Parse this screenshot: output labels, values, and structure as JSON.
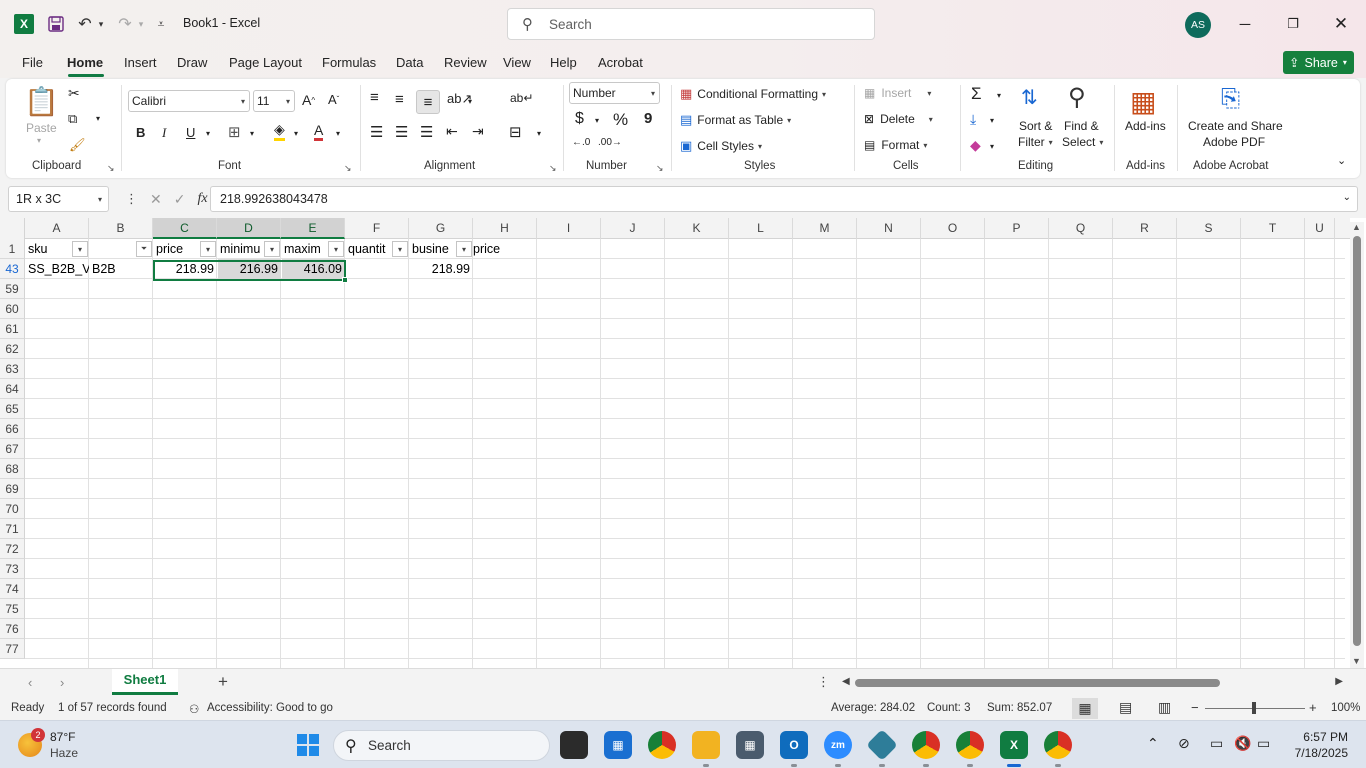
{
  "titlebar": {
    "app_logo": "X",
    "doc_title": "Book1  -  Excel",
    "search_placeholder": "Search",
    "avatar_initials": "AS"
  },
  "menu": {
    "tabs": [
      "File",
      "Home",
      "Insert",
      "Draw",
      "Page Layout",
      "Formulas",
      "Data",
      "Review",
      "View",
      "Help",
      "Acrobat"
    ],
    "share_label": "Share"
  },
  "ribbon": {
    "clipboard": {
      "label": "Clipboard",
      "paste": "Paste"
    },
    "font": {
      "label": "Font",
      "name": "Calibri",
      "size": "11",
      "bold": "B",
      "italic": "I",
      "underline": "U"
    },
    "alignment": {
      "label": "Alignment"
    },
    "number": {
      "label": "Number",
      "format": "Number",
      "currency": "$",
      "percent": "%",
      "comma": "9"
    },
    "styles": {
      "label": "Styles",
      "conditional": "Conditional Formatting",
      "table": "Format as Table",
      "cell_styles": "Cell Styles"
    },
    "cells": {
      "label": "Cells",
      "insert": "Insert",
      "delete": "Delete",
      "format": "Format"
    },
    "editing": {
      "label": "Editing",
      "sort": "Sort &",
      "sort2": "Filter",
      "find": "Find &",
      "find2": "Select"
    },
    "addins": {
      "label": "Add-ins",
      "button": "Add-ins"
    },
    "acrobat": {
      "label": "Adobe Acrobat",
      "line1": "Create and Share",
      "line2": "Adobe PDF"
    }
  },
  "formula_bar": {
    "name_box": "1R x 3C",
    "formula_value": "218.992638043478"
  },
  "grid": {
    "columns": [
      "A",
      "B",
      "C",
      "D",
      "E",
      "F",
      "G",
      "H",
      "I",
      "J",
      "K",
      "L",
      "M",
      "N",
      "O",
      "P",
      "Q",
      "R",
      "S",
      "T",
      "U"
    ],
    "headers": [
      "sku",
      "",
      "price",
      "minimu",
      "maxim",
      "quantit",
      "busine",
      "price"
    ],
    "row_numbers": [
      "1",
      "43",
      "59",
      "60",
      "61",
      "62",
      "63",
      "64",
      "65",
      "66",
      "67",
      "68",
      "69",
      "70",
      "71",
      "72",
      "73",
      "74",
      "75",
      "76",
      "77"
    ],
    "row43": {
      "a": "SS_B2B_V",
      "b": "B2B",
      "c": "218.99",
      "d": "216.99",
      "e": "416.09",
      "g": "218.99"
    }
  },
  "sheets": {
    "tab": "Sheet1"
  },
  "status": {
    "ready": "Ready",
    "records": "1 of 57 records found",
    "accessibility": "Accessibility: Good to go",
    "average": "Average: 284.02",
    "count": "Count: 3",
    "sum": "Sum: 852.07",
    "zoom": "100%"
  },
  "taskbar": {
    "weather_badge": "2",
    "temperature": "87°F",
    "condition": "Haze",
    "search_placeholder": "Search",
    "time": "6:57 PM",
    "date": "7/18/2025"
  },
  "colors": {
    "excel_green": "#107c41",
    "share_green": "#16803d",
    "selection_fill": "#d9d9d9"
  }
}
